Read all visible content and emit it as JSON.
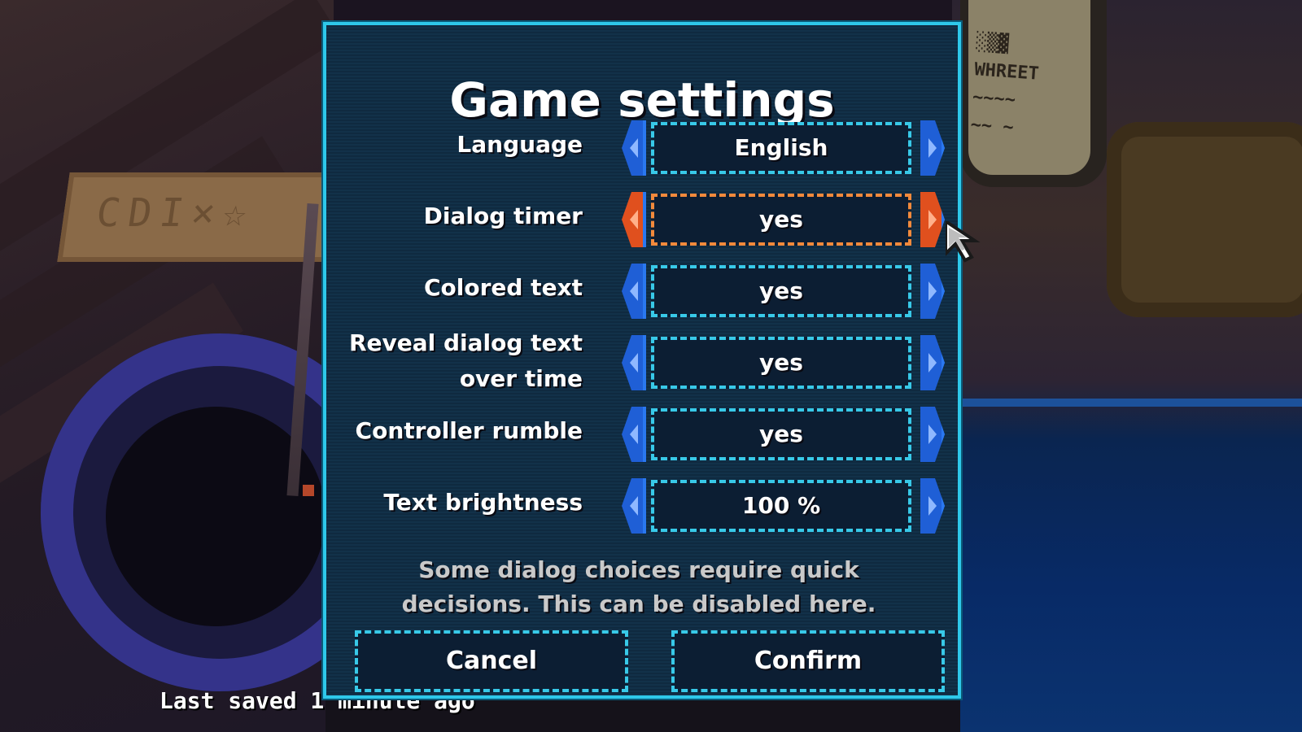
{
  "dialog": {
    "title": "Game settings",
    "settings": [
      {
        "label": "Language",
        "value": "English"
      },
      {
        "label": "Dialog timer",
        "value": "yes"
      },
      {
        "label": "Colored text",
        "value": "yes"
      },
      {
        "label": "Reveal dialog text",
        "label2": "over time",
        "value": "yes"
      },
      {
        "label": "Controller rumble",
        "value": "yes"
      },
      {
        "label": "Text brightness",
        "value": "100 %"
      }
    ],
    "hint_line1": "Some dialog choices require quick",
    "hint_line2": "decisions. This can be disabled here.",
    "cancel_label": "Cancel",
    "confirm_label": "Confirm"
  },
  "status": {
    "last_saved": "Last saved 1 minute ago"
  },
  "colors": {
    "border": "#2ec8ea",
    "active": "#f28a3c",
    "arrow": "#1f5fd6",
    "arrow_active": "#e0501e"
  },
  "icons": {
    "previous": "arrow-left-icon",
    "next": "arrow-right-icon",
    "pointer": "mouse-cursor-icon"
  }
}
